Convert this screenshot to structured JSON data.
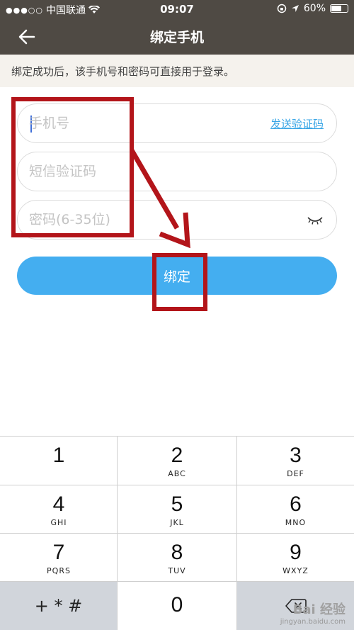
{
  "status_bar": {
    "carrier": "中国联通",
    "signal": "●●●○○",
    "time": "09:07",
    "battery": "60%"
  },
  "header": {
    "title": "绑定手机"
  },
  "notice": {
    "text": "绑定成功后，该手机号和密码可直接用于登录。"
  },
  "form": {
    "phone_placeholder": "手机号",
    "send_code_label": "发送验证码",
    "sms_placeholder": "短信验证码",
    "password_placeholder": "密码(6-35位)",
    "bind_button_label": "绑定"
  },
  "keypad": {
    "keys": [
      {
        "num": "1",
        "letters": ""
      },
      {
        "num": "2",
        "letters": "ABC"
      },
      {
        "num": "3",
        "letters": "DEF"
      },
      {
        "num": "4",
        "letters": "GHI"
      },
      {
        "num": "5",
        "letters": "JKL"
      },
      {
        "num": "6",
        "letters": "MNO"
      },
      {
        "num": "7",
        "letters": "PQRS"
      },
      {
        "num": "8",
        "letters": "TUV"
      },
      {
        "num": "9",
        "letters": "WXYZ"
      },
      {
        "num": "+ * #",
        "letters": ""
      },
      {
        "num": "0",
        "letters": ""
      }
    ]
  },
  "watermark": {
    "main": "Bai 经验",
    "sub": "jingyan.baidu.com"
  },
  "colors": {
    "header_bg": "#4f4a44",
    "notice_bg": "#f5f2ed",
    "accent_blue": "#44aef0",
    "link_blue": "#3aa6e6",
    "annotation_red": "#b3151a"
  }
}
